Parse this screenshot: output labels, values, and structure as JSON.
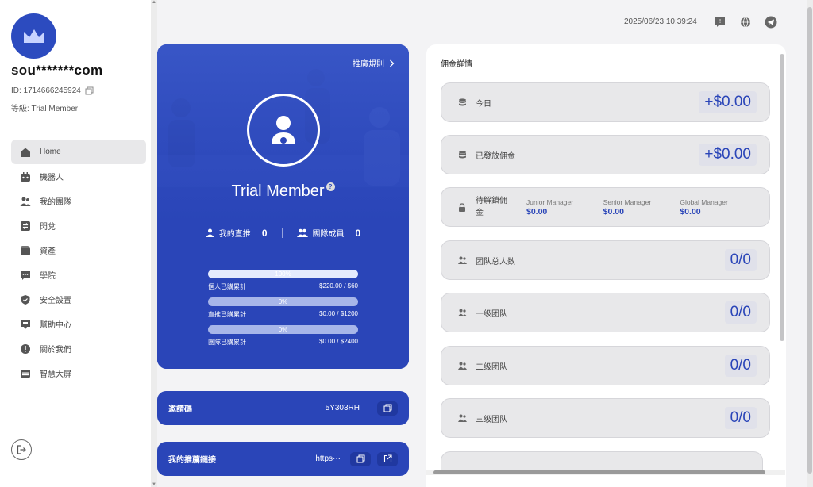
{
  "user": {
    "masked_email": "sou*******com",
    "id_text": "ID: 1714666245924",
    "level_text": "等級: Trial Member"
  },
  "sidebar": {
    "items": [
      {
        "label": "Home",
        "icon": "home-icon",
        "active": true
      },
      {
        "label": "機器人",
        "icon": "robot-icon"
      },
      {
        "label": "我的團隊",
        "icon": "team-icon"
      },
      {
        "label": "閃兌",
        "icon": "swap-icon"
      },
      {
        "label": "資產",
        "icon": "wallet-icon"
      },
      {
        "label": "學院",
        "icon": "chat-icon"
      },
      {
        "label": "安全設置",
        "icon": "shield-icon"
      },
      {
        "label": "幫助中心",
        "icon": "help-icon"
      },
      {
        "label": "關於我們",
        "icon": "info-icon"
      },
      {
        "label": "智慧大屏",
        "icon": "screen-icon"
      }
    ]
  },
  "header": {
    "datetime": "2025/06/23 10:39:24"
  },
  "member_card": {
    "rules_label": "推廣規則",
    "title": "Trial Member",
    "direct_label": "我的直推",
    "direct_count": "0",
    "team_label": "團隊成員",
    "team_count": "0",
    "progress": [
      {
        "pct": "100%",
        "fill": 1.0,
        "label": "個人已購累計",
        "value": "$220.00 / $60"
      },
      {
        "pct": "0%",
        "fill": 0,
        "label": "直推已購累計",
        "value": "$0.00 / $1200"
      },
      {
        "pct": "0%",
        "fill": 0,
        "label": "團隊已購累計",
        "value": "$0.00 / $2400"
      }
    ]
  },
  "invite": {
    "label": "邀請碼",
    "code": "5Y303RH"
  },
  "referral": {
    "label": "我的推薦鏈接",
    "value": "https···"
  },
  "commission": {
    "title": "佣金詳情",
    "today_label": "今日",
    "today_value": "+$0.00",
    "paid_label": "已發放佣金",
    "paid_value": "+$0.00",
    "locked_label": "待解鎖佣金",
    "tiers": [
      {
        "name": "Junior Manager",
        "value": "$0.00"
      },
      {
        "name": "Senior Manager",
        "value": "$0.00"
      },
      {
        "name": "Global Manager",
        "value": "$0.00"
      }
    ],
    "team_total_label": "团队总人数",
    "team_total_value": "0/0",
    "level1_label": "一级团队",
    "level1_value": "0/0",
    "level2_label": "二级团队",
    "level2_value": "0/0",
    "level3_label": "三级团队",
    "level3_value": "0/0"
  },
  "colors": {
    "brand": "#2a45b8",
    "row_bg": "#e8e8ea"
  }
}
